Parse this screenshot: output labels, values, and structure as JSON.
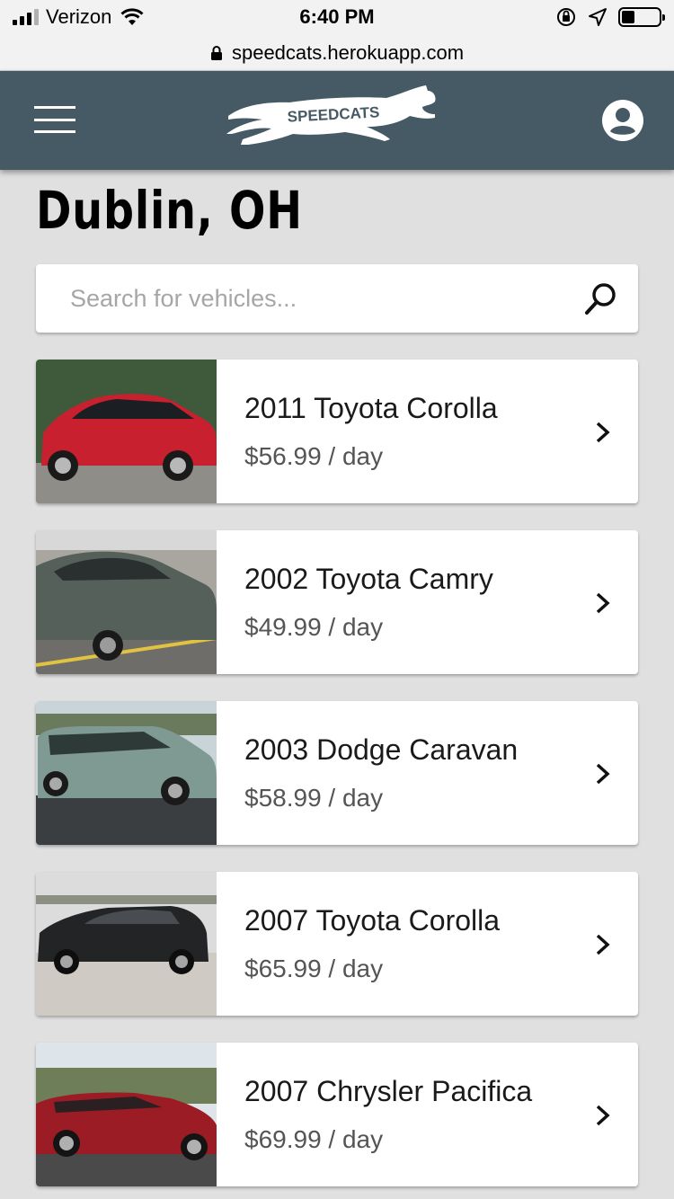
{
  "status_bar": {
    "carrier": "Verizon",
    "time": "6:40 PM",
    "icons": [
      "signal-icon",
      "wifi-icon",
      "orientation-lock-icon",
      "location-icon",
      "battery-icon"
    ]
  },
  "browser": {
    "url": "speedcats.herokuapp.com",
    "icon": "lock-icon"
  },
  "header": {
    "logo_text": "SPEEDCATS",
    "menu_icon": "hamburger-menu-icon",
    "account_icon": "account-circle-icon",
    "color": "#455a64"
  },
  "page": {
    "title": "Dublin, OH"
  },
  "search": {
    "placeholder": "Search for vehicles...",
    "value": "",
    "icon": "search-icon"
  },
  "vehicles": [
    {
      "name": "2011 Toyota Corolla",
      "price": "$56.99 / day",
      "color": "#c8202e"
    },
    {
      "name": "2002 Toyota Camry",
      "price": "$49.99 / day",
      "color": "#55605a"
    },
    {
      "name": "2003 Dodge Caravan",
      "price": "$58.99 / day",
      "color": "#7f9a92"
    },
    {
      "name": "2007 Toyota Corolla",
      "price": "$65.99 / day",
      "color": "#222426"
    },
    {
      "name": "2007 Chrysler Pacifica",
      "price": "$69.99 / day",
      "color": "#9b1c24"
    }
  ]
}
